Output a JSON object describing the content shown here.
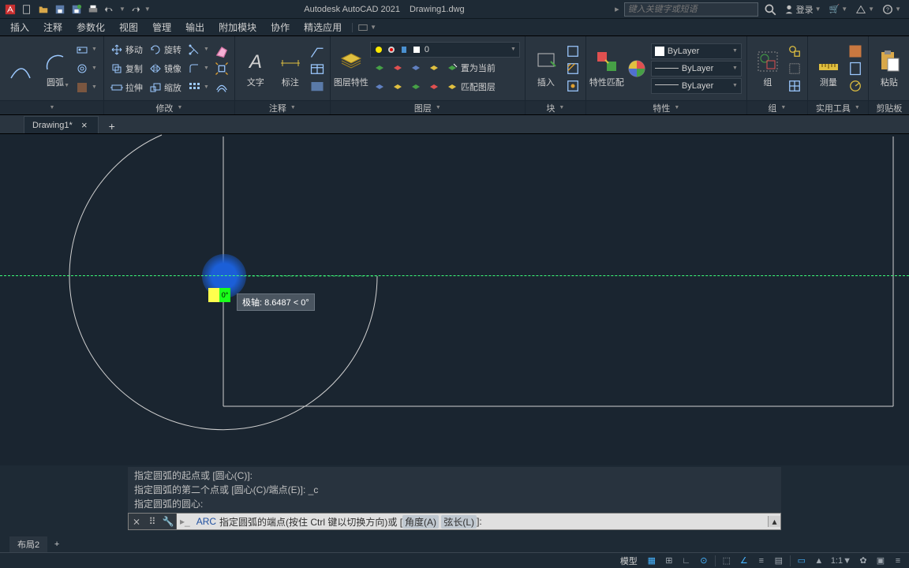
{
  "title": {
    "app": "Autodesk AutoCAD 2021",
    "doc": "Drawing1.dwg"
  },
  "search": {
    "placeholder": "键入关键字或短语"
  },
  "account": {
    "login": "登录"
  },
  "menus": [
    "插入",
    "注释",
    "参数化",
    "视图",
    "管理",
    "输出",
    "附加模块",
    "协作",
    "精选应用"
  ],
  "ribbon": {
    "draw": {
      "arc": "圆弧"
    },
    "modify": {
      "move": "移动",
      "copy": "复制",
      "stretch": "拉伸",
      "rotate": "旋转",
      "mirror": "镜像",
      "scale": "缩放",
      "title": "修改"
    },
    "annotate": {
      "text": "文字",
      "dim": "标注",
      "title": "注释"
    },
    "layer": {
      "props": "图层特性",
      "title": "图层",
      "current": "0",
      "setcur": "置为当前",
      "match": "匹配图层"
    },
    "block": {
      "insert": "插入",
      "title": "块"
    },
    "props": {
      "match": "特性匹配",
      "bylayer": "ByLayer",
      "title": "特性"
    },
    "group": {
      "group": "组",
      "title": "组"
    },
    "util": {
      "measure": "测量",
      "title": "实用工具"
    },
    "clip": {
      "paste": "粘贴",
      "title": "剪贴板"
    }
  },
  "tabs": {
    "file": "Drawing1*"
  },
  "dyninput": {
    "degree": "0°",
    "tip": "极轴: 8.6487 < 0°"
  },
  "cmd": {
    "h1": "指定圆弧的起点或 [圆心(C)]:",
    "h2": "指定圆弧的第二个点或 [圆心(C)/端点(E)]: _c",
    "h3": "指定圆弧的圆心:",
    "name": "ARC",
    "prompt_pre": "指定圆弧的端点(按住 Ctrl 键以切换方向)或 [",
    "opt1": "角度(A)",
    "opt2": "弦长(L)",
    "prompt_post": "]:"
  },
  "layout": {
    "tab": "布局2"
  },
  "status": {
    "model": "模型",
    "scale": "1:1"
  }
}
